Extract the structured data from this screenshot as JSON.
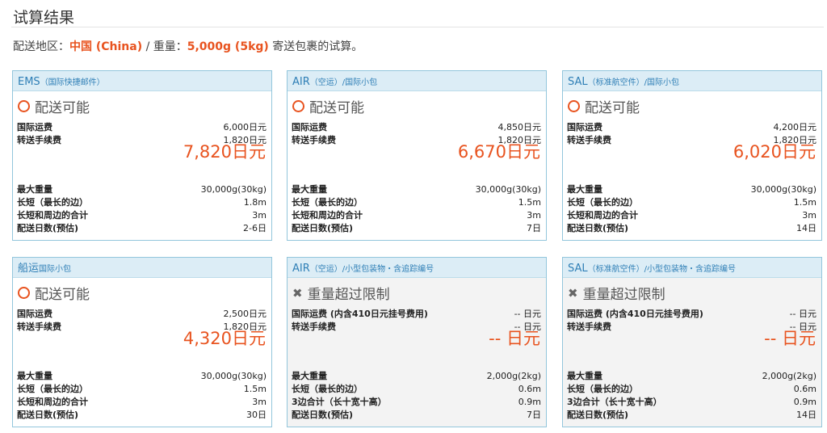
{
  "page": {
    "title": "试算结果",
    "summary": {
      "region_label": "配送地区：",
      "region_value": "中国 (China)",
      "sep": " / 重量：",
      "weight_value": "5,000g (5kg)",
      "suffix": " 寄送包裹的试算。"
    }
  },
  "colors": {
    "accent": "#e8531f",
    "header_bg": "#dcedf6",
    "header_text": "#2f7fb6",
    "border": "#93c6dc"
  },
  "cards": [
    {
      "service": "EMS",
      "sub": "（国际快捷邮件）",
      "available": true,
      "status_icon": "circle-icon",
      "status": "配送可能",
      "fee_rows": [
        {
          "label": "国际运费",
          "value": "6,000日元"
        },
        {
          "label": "转送手续费",
          "value": "1,820日元"
        }
      ],
      "total": "7,820日元",
      "spec_rows": [
        {
          "label": "最大重量",
          "value": "30,000g(30kg)"
        },
        {
          "label": "长短（最长的边）",
          "value": "1.8m"
        },
        {
          "label": "长短和周边的合计",
          "value": "3m"
        },
        {
          "label": "配送日数(预估)",
          "value": "2-6日"
        }
      ]
    },
    {
      "service": "AIR",
      "sub": "（空运）/国际小包",
      "available": true,
      "status_icon": "circle-icon",
      "status": "配送可能",
      "fee_rows": [
        {
          "label": "国际运费",
          "value": "4,850日元"
        },
        {
          "label": "转送手续费",
          "value": "1,820日元"
        }
      ],
      "total": "6,670日元",
      "spec_rows": [
        {
          "label": "最大重量",
          "value": "30,000g(30kg)"
        },
        {
          "label": "长短（最长的边）",
          "value": "1.5m"
        },
        {
          "label": "长短和周边的合计",
          "value": "3m"
        },
        {
          "label": "配送日数(预估)",
          "value": "7日"
        }
      ]
    },
    {
      "service": "SAL",
      "sub": "（标准航空件）/国际小包",
      "available": true,
      "status_icon": "circle-icon",
      "status": "配送可能",
      "fee_rows": [
        {
          "label": "国际运费",
          "value": "4,200日元"
        },
        {
          "label": "转送手续费",
          "value": "1,820日元"
        }
      ],
      "total": "6,020日元",
      "spec_rows": [
        {
          "label": "最大重量",
          "value": "30,000g(30kg)"
        },
        {
          "label": "长短（最长的边）",
          "value": "1.5m"
        },
        {
          "label": "长短和周边的合计",
          "value": "3m"
        },
        {
          "label": "配送日数(预估)",
          "value": "14日"
        }
      ]
    },
    {
      "service": "船运",
      "sub": "国际小包",
      "available": true,
      "status_icon": "circle-icon",
      "status": "配送可能",
      "fee_rows": [
        {
          "label": "国际运费",
          "value": "2,500日元"
        },
        {
          "label": "转送手续费",
          "value": "1,820日元"
        }
      ],
      "total": "4,320日元",
      "spec_rows": [
        {
          "label": "最大重量",
          "value": "30,000g(30kg)"
        },
        {
          "label": "长短（最长的边）",
          "value": "1.5m"
        },
        {
          "label": "长短和周边的合计",
          "value": "3m"
        },
        {
          "label": "配送日数(预估)",
          "value": "30日"
        }
      ]
    },
    {
      "service": "AIR",
      "sub": "（空运）/小型包装物・含追踪编号",
      "available": false,
      "status_icon": "cross-icon",
      "status": "重量超过限制",
      "fee_rows": [
        {
          "label": "国际运费 (内含410日元挂号费用)",
          "value": "-- 日元"
        },
        {
          "label": "转送手续费",
          "value": "-- 日元"
        }
      ],
      "total": "-- 日元",
      "spec_rows": [
        {
          "label": "最大重量",
          "value": "2,000g(2kg)"
        },
        {
          "label": "长短（最长的边）",
          "value": "0.6m"
        },
        {
          "label": "3边合计（长十宽十高）",
          "value": "0.9m"
        },
        {
          "label": "配送日数(预估)",
          "value": "7日"
        }
      ]
    },
    {
      "service": "SAL",
      "sub": "（标准航空件）/小型包装物・含追踪编号",
      "available": false,
      "status_icon": "cross-icon",
      "status": "重量超过限制",
      "fee_rows": [
        {
          "label": "国际运费 (内含410日元挂号费用)",
          "value": "-- 日元"
        },
        {
          "label": "转送手续费",
          "value": "-- 日元"
        }
      ],
      "total": "-- 日元",
      "spec_rows": [
        {
          "label": "最大重量",
          "value": "2,000g(2kg)"
        },
        {
          "label": "长短（最长的边）",
          "value": "0.6m"
        },
        {
          "label": "3边合计（长十宽十高）",
          "value": "0.9m"
        },
        {
          "label": "配送日数(预估)",
          "value": "14日"
        }
      ]
    }
  ]
}
